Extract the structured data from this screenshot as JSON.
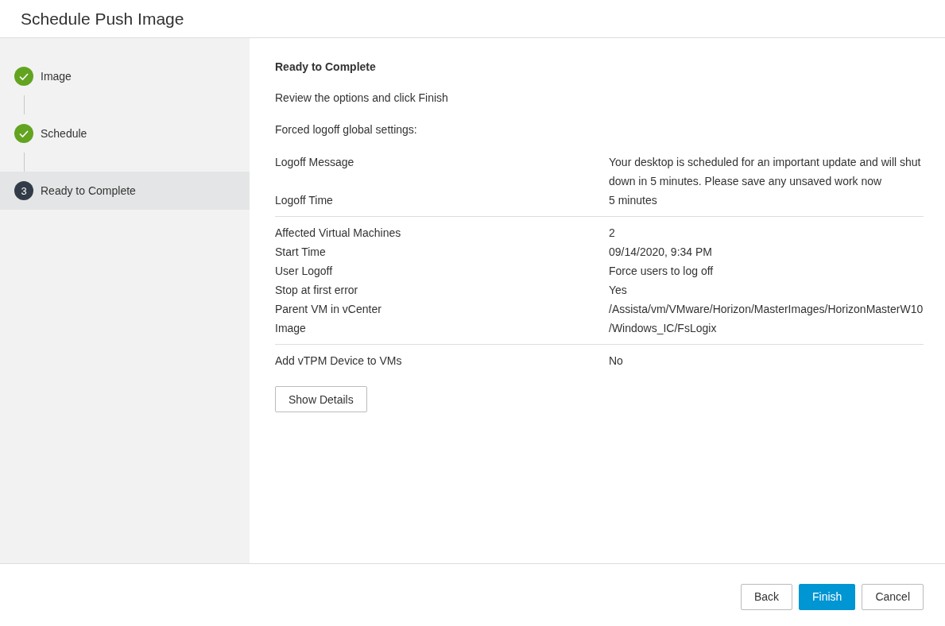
{
  "window": {
    "title": "Schedule Push Image"
  },
  "steps": [
    {
      "label": "Image",
      "kind": "done",
      "selected": false
    },
    {
      "label": "Schedule",
      "kind": "done",
      "selected": false
    },
    {
      "label": "Ready to Complete",
      "kind": "current",
      "number": "3",
      "selected": true
    }
  ],
  "content": {
    "heading": "Ready to Complete",
    "intro": "Review the options and click Finish",
    "settings_label": "Forced logoff global settings:",
    "sections": [
      {
        "rows": [
          {
            "label": "Logoff Message",
            "value": "Your desktop is scheduled for an important update and will shut down in 5 minutes. Please save any unsaved work now"
          },
          {
            "label": "Logoff Time",
            "value": "5 minutes"
          }
        ]
      },
      {
        "rows": [
          {
            "label": "Affected Virtual Machines",
            "value": "2"
          },
          {
            "label": "Start Time",
            "value": "09/14/2020, 9:34 PM"
          },
          {
            "label": "User Logoff",
            "value": "Force users to log off"
          },
          {
            "label": "Stop at first error",
            "value": "Yes"
          },
          {
            "label": "Parent VM in vCenter",
            "value": "/Assista/vm/VMware/Horizon/MasterImages/HorizonMasterW10"
          },
          {
            "label": "Image",
            "value": "/Windows_IC/FsLogix"
          }
        ]
      },
      {
        "rows": [
          {
            "label": "Add vTPM Device to VMs",
            "value": "No"
          }
        ]
      }
    ],
    "details_button": "Show Details"
  },
  "buttons": [
    {
      "label": "Back",
      "kind": "default"
    },
    {
      "label": "Finish",
      "kind": "primary"
    },
    {
      "label": "Cancel",
      "kind": "default"
    }
  ]
}
